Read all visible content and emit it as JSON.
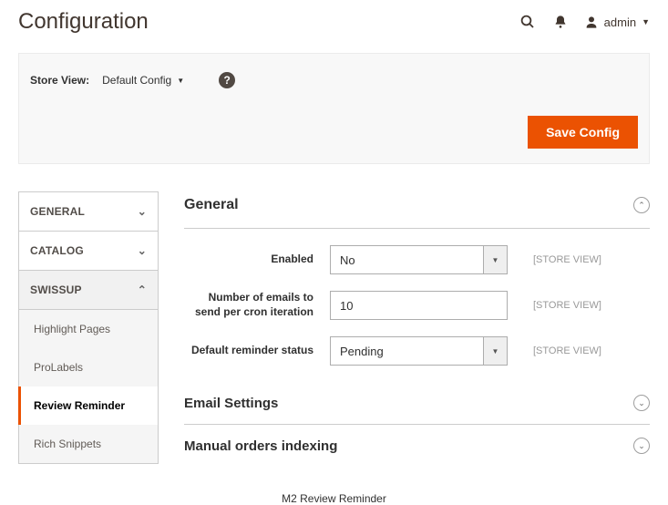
{
  "header": {
    "title": "Configuration",
    "user": "admin"
  },
  "storeBar": {
    "label": "Store View:",
    "selected": "Default Config",
    "saveLabel": "Save Config"
  },
  "sidebar": {
    "sections": [
      {
        "label": "GENERAL"
      },
      {
        "label": "CATALOG"
      },
      {
        "label": "SWISSUP"
      }
    ],
    "swissupItems": [
      {
        "label": "Highlight Pages"
      },
      {
        "label": "ProLabels"
      },
      {
        "label": "Review Reminder"
      },
      {
        "label": "Rich Snippets"
      }
    ]
  },
  "sections": {
    "general": {
      "title": "General",
      "fields": {
        "enabled": {
          "label": "Enabled",
          "value": "No",
          "scope": "[STORE VIEW]"
        },
        "numEmails": {
          "label": "Number of emails to send per cron iteration",
          "value": "10",
          "scope": "[STORE VIEW]"
        },
        "defaultStatus": {
          "label": "Default reminder status",
          "value": "Pending",
          "scope": "[STORE VIEW]"
        }
      }
    },
    "emailSettings": {
      "title": "Email Settings"
    },
    "manualIndexing": {
      "title": "Manual orders indexing"
    }
  },
  "caption": "M2 Review Reminder"
}
